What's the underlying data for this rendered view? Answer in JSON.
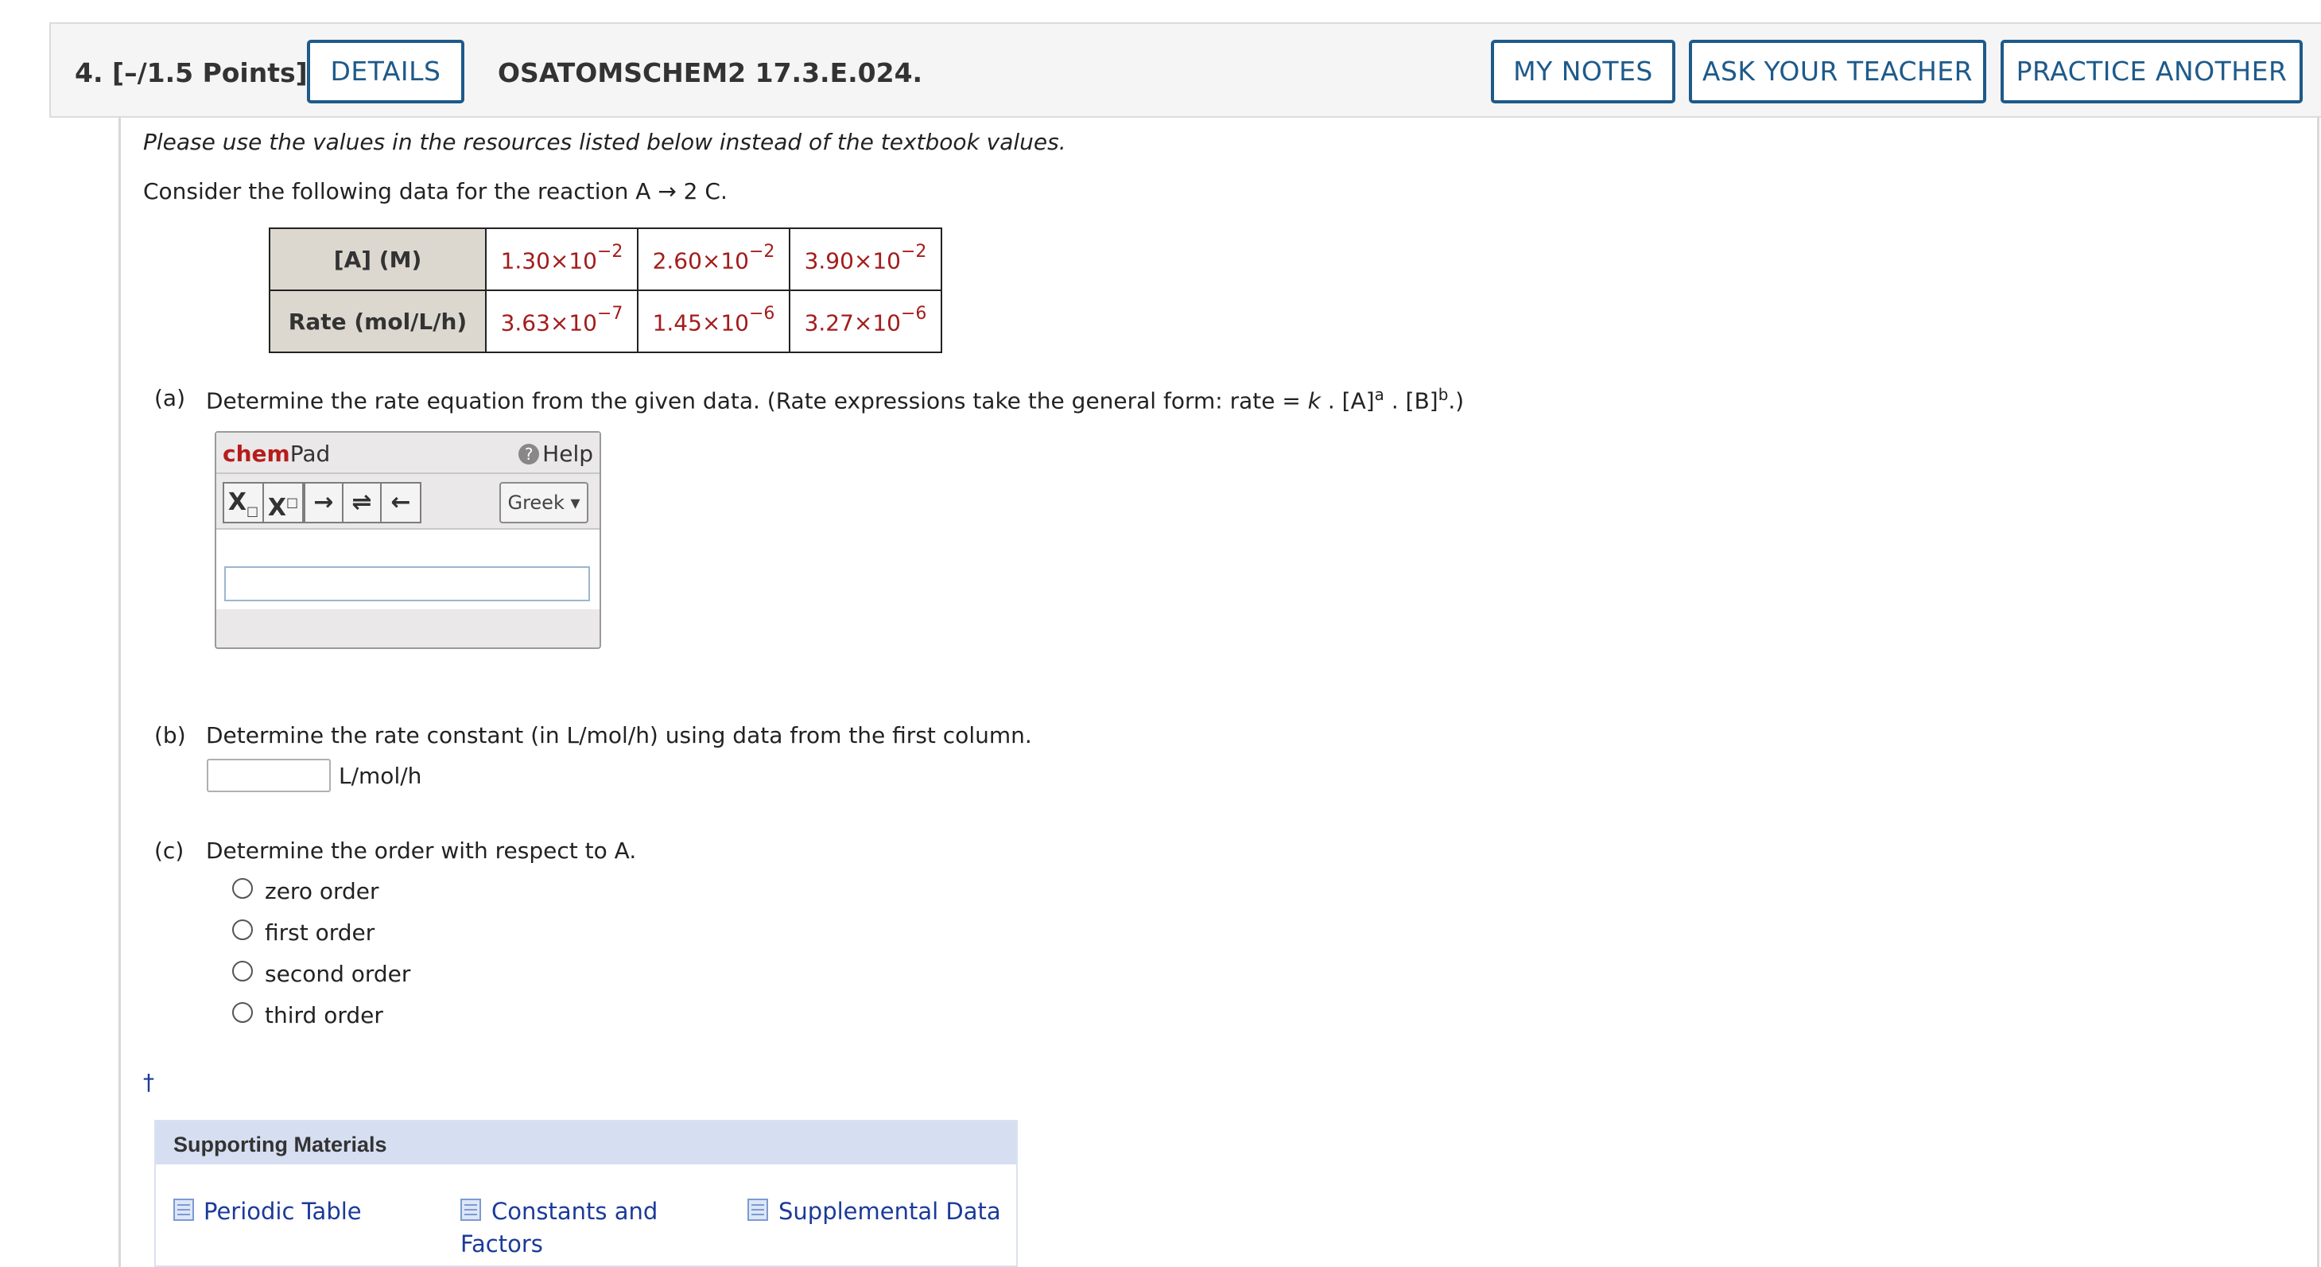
{
  "header": {
    "question_label": "4. [–/1.5 Points]",
    "details_button": "DETAILS",
    "question_code": "OSATOMSCHEM2 17.3.E.024.",
    "my_notes_button": "MY NOTES",
    "ask_teacher_button": "ASK YOUR TEACHER",
    "practice_button": "PRACTICE ANOTHER"
  },
  "intro": {
    "note": "Please use the values in the resources listed below instead of the textbook values.",
    "prompt": "Consider the following data for the reaction A → 2 C."
  },
  "table": {
    "row1_header": "[A] (M)",
    "row2_header": "Rate (mol/L/h)",
    "row1": [
      {
        "mant": "1.30×10",
        "exp": "−2"
      },
      {
        "mant": "2.60×10",
        "exp": "−2"
      },
      {
        "mant": "3.90×10",
        "exp": "−2"
      }
    ],
    "row2": [
      {
        "mant": "3.63×10",
        "exp": "−7"
      },
      {
        "mant": "1.45×10",
        "exp": "−6"
      },
      {
        "mant": "3.27×10",
        "exp": "−6"
      }
    ]
  },
  "part_a": {
    "label": "(a)",
    "text_before": "Determine the rate equation from the given data. (Rate expressions take the general form: rate = ",
    "k": "k",
    "text_mid": " . [A]",
    "sup_a": "a",
    "text_mid2": " . [B]",
    "sup_b": "b",
    "text_end": ".)"
  },
  "chempad": {
    "brand_bold": "chem",
    "brand_rest": "Pad",
    "help": "Help",
    "greek": "Greek",
    "input_value": ""
  },
  "part_b": {
    "label": "(b)",
    "text": "Determine the rate constant (in L/mol/h) using data from the first column.",
    "unit": "L/mol/h",
    "input_value": ""
  },
  "part_c": {
    "label": "(c)",
    "text": "Determine the order with respect to A.",
    "options": [
      "zero order",
      "first order",
      "second order",
      "third order"
    ]
  },
  "dagger": "†",
  "supporting": {
    "title": "Supporting Materials",
    "links": [
      "Periodic Table",
      "Constants and",
      "Factors",
      "Supplemental Data"
    ]
  }
}
